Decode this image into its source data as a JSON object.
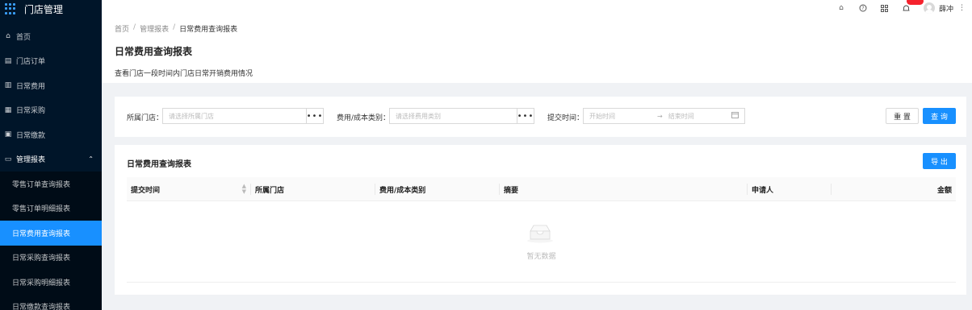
{
  "app": {
    "title": "门店管理"
  },
  "sidebar": {
    "items": [
      {
        "label": "首页",
        "icon": "home-icon"
      },
      {
        "label": "门店订单",
        "icon": "order-icon"
      },
      {
        "label": "日常费用",
        "icon": "expense-icon"
      },
      {
        "label": "日常采购",
        "icon": "purchase-icon"
      },
      {
        "label": "日常缴款",
        "icon": "payment-icon"
      }
    ],
    "group": {
      "label": "管理报表",
      "icon": "calendar-icon",
      "expanded": true
    },
    "subitems": [
      {
        "label": "零售订单查询报表",
        "active": false
      },
      {
        "label": "零售订单明细报表",
        "active": false
      },
      {
        "label": "日常费用查询报表",
        "active": true
      },
      {
        "label": "日常采购查询报表",
        "active": false
      },
      {
        "label": "日常采购明细报表",
        "active": false
      },
      {
        "label": "日常缴款查询报表",
        "active": false
      }
    ]
  },
  "header": {
    "icons": [
      "home-icon",
      "help-icon",
      "grid-icon",
      "bell-icon"
    ],
    "username": "薛冲"
  },
  "breadcrumb": [
    "首页",
    "管理报表",
    "日常费用查询报表"
  ],
  "page": {
    "title": "日常费用查询报表",
    "description": "查看门店一段时间内门店日常开销费用情况"
  },
  "filters": {
    "store_label": "所属门店：",
    "store_placeholder": "请选择所属门店",
    "category_label": "费用/成本类别：",
    "category_placeholder": "请选择费用类别",
    "time_label": "提交时间：",
    "start_placeholder": "开始时间",
    "end_placeholder": "结束时间",
    "reset_label": "重 置",
    "query_label": "查 询"
  },
  "table": {
    "title": "日常费用查询报表",
    "export_label": "导 出",
    "columns": [
      "提交时间",
      "所属门店",
      "费用/成本类别",
      "摘要",
      "申请人",
      "金额"
    ],
    "empty_text": "暂无数据"
  },
  "colors": {
    "accent": "#1890ff",
    "sidebar_bg": "#001529",
    "badge": "#f5222d"
  }
}
